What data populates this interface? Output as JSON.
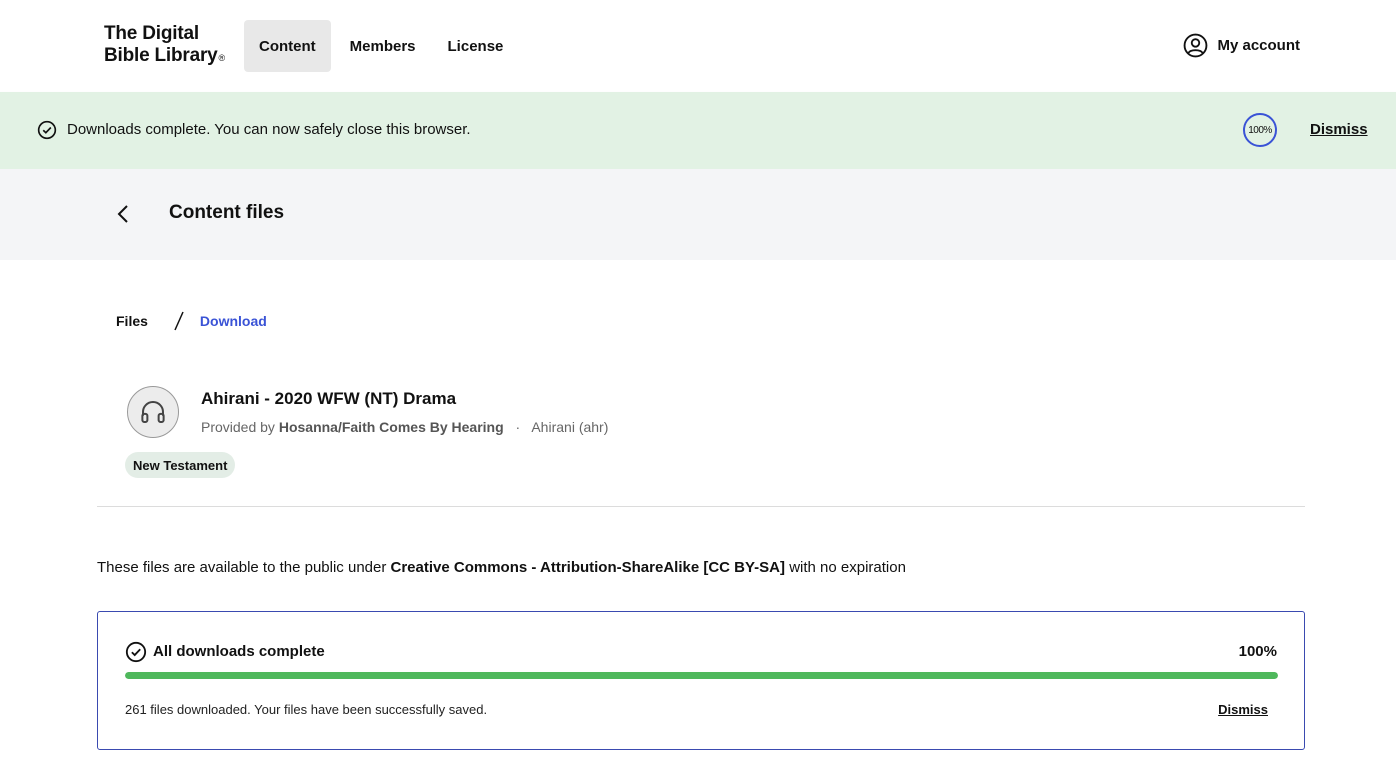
{
  "header": {
    "logo_line1": "The Digital",
    "logo_line2": "Bible Library",
    "logo_mark": "®",
    "nav": [
      {
        "label": "Content",
        "active": true
      },
      {
        "label": "Members",
        "active": false
      },
      {
        "label": "License",
        "active": false
      }
    ],
    "account_label": "My account"
  },
  "banner": {
    "message": "Downloads complete. You can now safely close this browser.",
    "progress_label": "100%",
    "progress": 1.0,
    "dismiss_label": "Dismiss"
  },
  "page": {
    "title": "Content files"
  },
  "breadcrumb": {
    "files": "Files",
    "current": "Download"
  },
  "resource": {
    "icon": "headphones-icon",
    "title": "Ahirani - 2020 WFW (NT) Drama",
    "provided_by_prefix": "Provided by",
    "provider": "Hosanna/Faith Comes By Hearing",
    "separator": "·",
    "language": "Ahirani (ahr)",
    "tag": "New Testament"
  },
  "license": {
    "prefix": "These files are available to the public under",
    "name": "Creative Commons - Attribution-ShareAlike [CC BY-SA]",
    "suffix": "with no expiration"
  },
  "download": {
    "title": "All downloads complete",
    "percent_label": "100%",
    "progress": 1.0,
    "summary": "261 files downloaded. Your files have been successfully saved.",
    "dismiss_label": "Dismiss"
  },
  "colors": {
    "accent": "#3a53d6",
    "banner_bg": "#e2f2e4",
    "progress_fill": "#4fb85c",
    "tag_bg": "#e3ede6"
  }
}
